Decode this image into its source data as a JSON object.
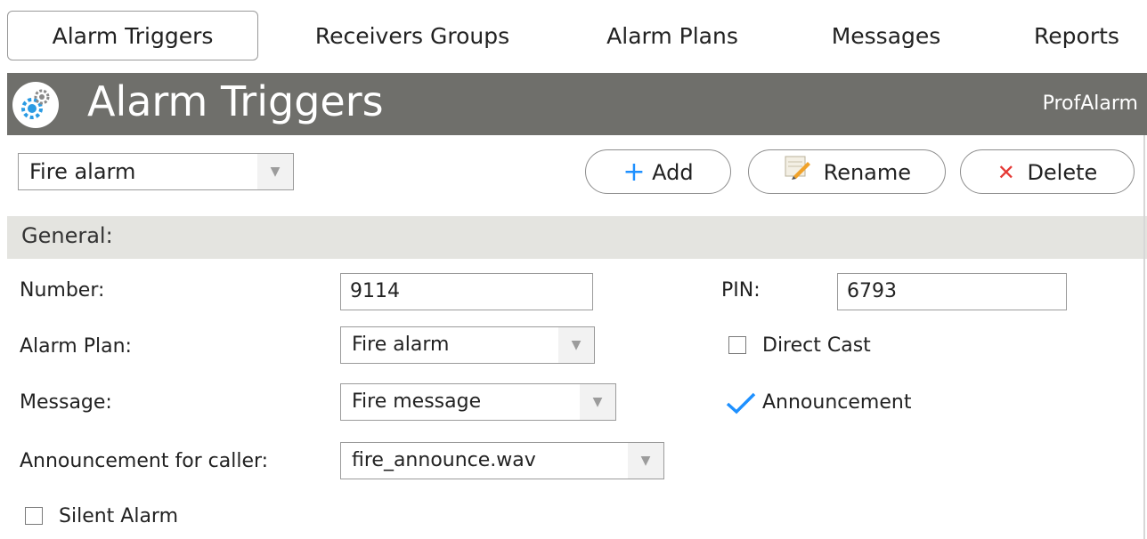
{
  "tabs": [
    "Alarm Triggers",
    "Receivers Groups",
    "Alarm Plans",
    "Messages",
    "Reports"
  ],
  "header": {
    "title": "Alarm Triggers",
    "brand": "ProfAlarm",
    "icon": "gear-app-icon"
  },
  "toolbar": {
    "trigger_select": "Fire alarm",
    "add_label": "Add",
    "rename_label": "Rename",
    "delete_label": "Delete"
  },
  "section": {
    "label": "General:"
  },
  "form": {
    "number_label": "Number:",
    "number_value": "9114",
    "pin_label": "PIN:",
    "pin_value": "6793",
    "alarm_plan_label": "Alarm Plan:",
    "alarm_plan_value": "Fire alarm",
    "direct_cast_label": "Direct Cast",
    "message_label": "Message:",
    "message_value": "Fire message",
    "announcement_label": "Announcement",
    "caller_announcement_label": "Announcement for caller:",
    "caller_announcement_value": "fire_announce.wav",
    "silent_alarm_label": "Silent Alarm"
  },
  "colors": {
    "header_bg": "#6f6f6b",
    "section_bg": "#e4e4e0",
    "accent_blue": "#1e90ff",
    "delete_red": "#e53935"
  }
}
